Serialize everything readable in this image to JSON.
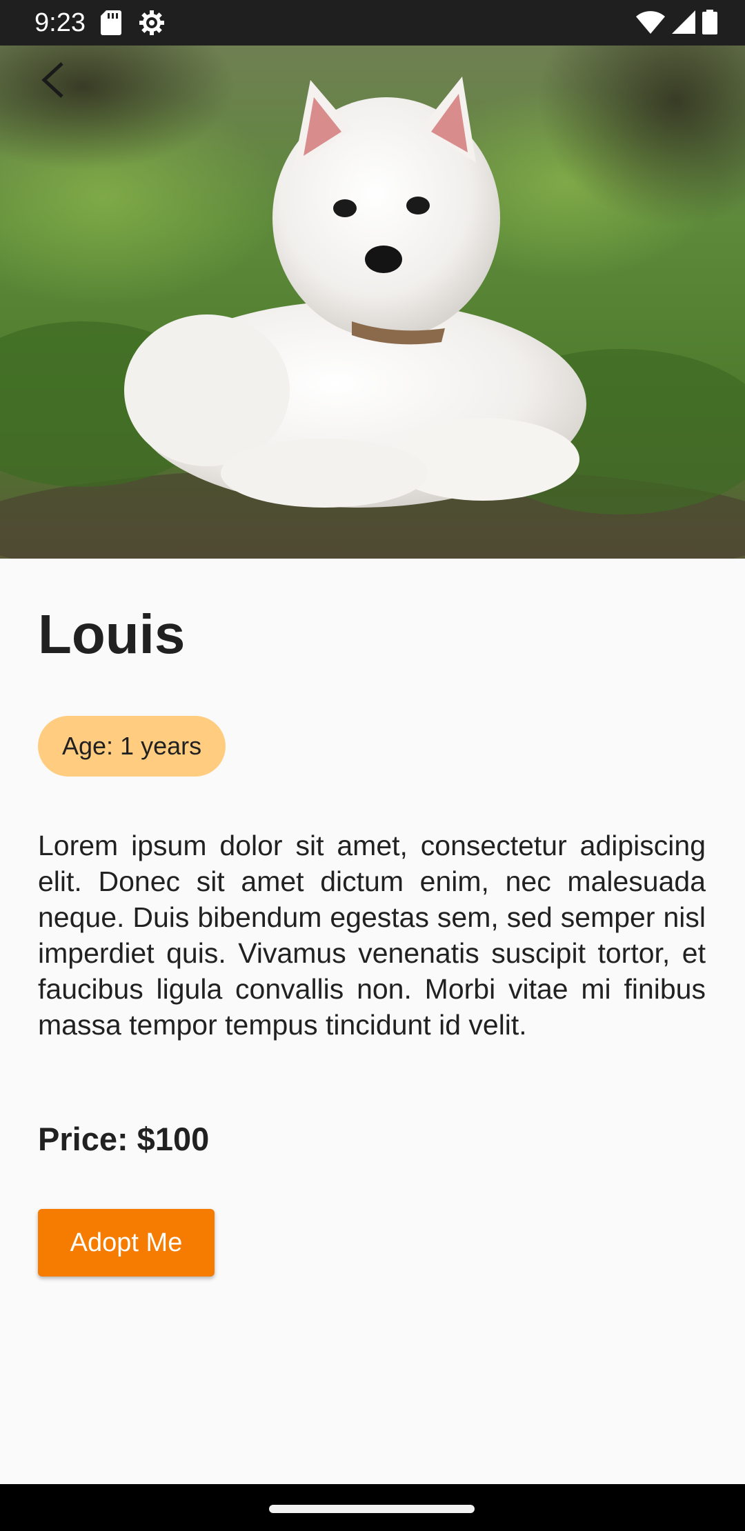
{
  "status_bar": {
    "time": "9:23",
    "icons": [
      "sd-card-icon",
      "settings-gear-icon",
      "wifi-icon",
      "signal-icon",
      "battery-icon"
    ]
  },
  "hero": {
    "image": "photo of white West Highland terrier lying in grass"
  },
  "pet": {
    "name": "Louis",
    "age_label": "Age: 1 years",
    "description": "Lorem ipsum dolor sit amet, consectetur adipiscing elit. Donec sit amet dictum enim, nec malesuada neque. Duis bibendum egestas sem, sed semper nisl imperdiet quis. Vivamus venenatis suscipit tortor, et faucibus ligula convallis non. Morbi vitae mi finibus massa tempor tempus tincidunt id velit.",
    "price_label": "Price: $100"
  },
  "actions": {
    "adopt_label": "Adopt Me"
  },
  "colors": {
    "accent": "#f57c00",
    "chip": "#ffcc80",
    "background": "#fafafa",
    "text": "#212121"
  }
}
